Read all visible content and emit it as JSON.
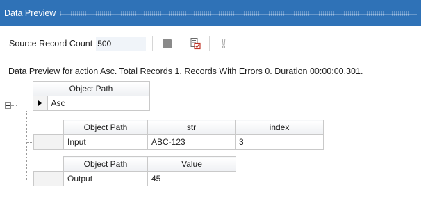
{
  "window": {
    "title": "Data Preview"
  },
  "toolbar": {
    "source_label": "Source Record Count",
    "source_value": "500",
    "buttons": [
      {
        "name": "stop",
        "icon": "stop-icon"
      },
      {
        "name": "preview",
        "icon": "checklist-icon"
      },
      {
        "name": "errors",
        "icon": "exclamation-icon"
      }
    ]
  },
  "status": {
    "text": "Data Preview for action Asc. Total Records 1. Records With Errors 0. Duration 00:00:00.301."
  },
  "grid": {
    "header": "Object Path",
    "row_value": "Asc",
    "input_table": {
      "headers": [
        "Object Path",
        "str",
        "index"
      ],
      "row": [
        "Input",
        "ABC-123",
        "3"
      ]
    },
    "output_table": {
      "headers": [
        "Object Path",
        "Value"
      ],
      "row": [
        "Output",
        "45"
      ]
    }
  },
  "colors": {
    "titlebar": "#2f72b7",
    "accent_red": "#c0392b"
  }
}
